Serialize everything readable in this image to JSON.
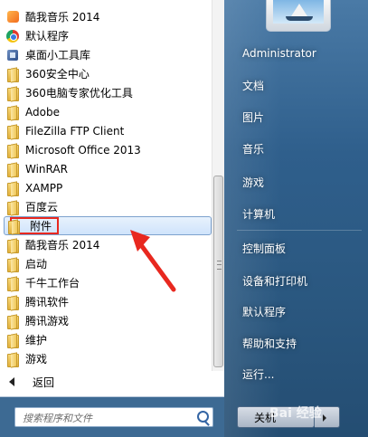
{
  "program_list": [
    {
      "label": "酷我音乐 2014",
      "icon": "kuwo-icon"
    },
    {
      "label": "默认程序",
      "icon": "default-programs-icon"
    },
    {
      "label": "桌面小工具库",
      "icon": "gadgets-icon"
    },
    {
      "label": "360安全中心",
      "icon": "folder-icon"
    },
    {
      "label": "360电脑专家优化工具",
      "icon": "folder-icon"
    },
    {
      "label": "Adobe",
      "icon": "folder-icon"
    },
    {
      "label": "FileZilla FTP Client",
      "icon": "folder-icon"
    },
    {
      "label": "Microsoft Office 2013",
      "icon": "folder-icon"
    },
    {
      "label": "WinRAR",
      "icon": "folder-icon"
    },
    {
      "label": "XAMPP",
      "icon": "folder-icon"
    },
    {
      "label": "百度云",
      "icon": "folder-icon"
    },
    {
      "label": "附件",
      "icon": "folder-icon",
      "highlighted": true
    },
    {
      "label": "酷我音乐 2014",
      "icon": "folder-icon"
    },
    {
      "label": "启动",
      "icon": "folder-icon"
    },
    {
      "label": "千牛工作台",
      "icon": "folder-icon"
    },
    {
      "label": "腾讯软件",
      "icon": "folder-icon"
    },
    {
      "label": "腾讯游戏",
      "icon": "folder-icon"
    },
    {
      "label": "维护",
      "icon": "folder-icon"
    },
    {
      "label": "游戏",
      "icon": "folder-icon"
    }
  ],
  "back": {
    "label": "返回"
  },
  "search": {
    "placeholder": "搜索程序和文件"
  },
  "right_panel": {
    "user": "Administrator",
    "items": [
      "文档",
      "图片",
      "音乐",
      "游戏",
      "计算机",
      "控制面板",
      "设备和打印机",
      "默认程序",
      "帮助和支持",
      "运行..."
    ]
  },
  "shutdown": {
    "label": "关机"
  },
  "watermark": "Bai 经验",
  "colors": {
    "highlight_border": "#e8281f",
    "annotation_arrow": "#e8281f"
  }
}
